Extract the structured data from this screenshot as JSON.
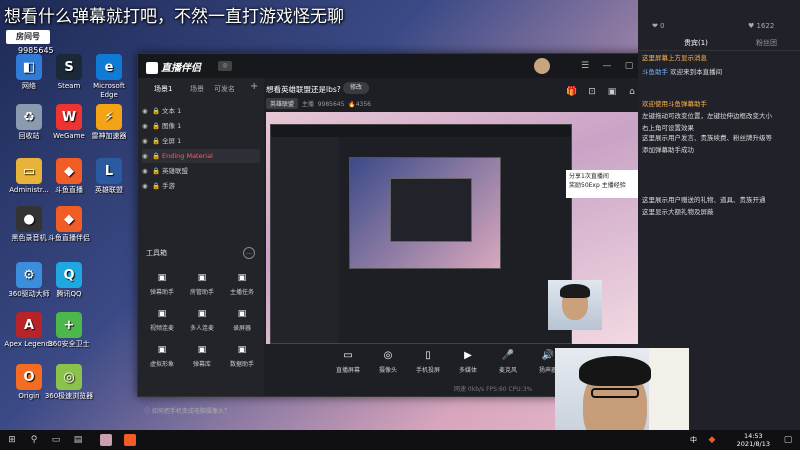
{
  "stream": {
    "title": "想看什么弹幕就打吧，不然一直打游戏怪无聊",
    "viewer_badge": "房间号",
    "viewer_count": "9985645"
  },
  "desktop": {
    "icons": [
      {
        "label": "网络",
        "icon": "network-icon",
        "color": "#2f7bd6",
        "glyph": "◧"
      },
      {
        "label": "Steam",
        "icon": "steam-icon",
        "color": "#1b2838",
        "glyph": "S"
      },
      {
        "label": "Microsoft Edge",
        "icon": "edge-icon",
        "color": "#0f7bd4",
        "glyph": "e"
      },
      {
        "label": "回收站",
        "icon": "recycle-bin-icon",
        "color": "#8a9bb0",
        "glyph": "♻"
      },
      {
        "label": "WeGame",
        "icon": "wegame-icon",
        "color": "#e33",
        "glyph": "W"
      },
      {
        "label": "雷神加速器",
        "icon": "leishen-icon",
        "color": "#f3a313",
        "glyph": "⚡"
      },
      {
        "label": "Administr...",
        "icon": "folder-icon",
        "color": "#e8b33a",
        "glyph": "▭"
      },
      {
        "label": "斗鱼直播",
        "icon": "douyu-icon",
        "color": "#f25c25",
        "glyph": "◆"
      },
      {
        "label": "英雄联盟",
        "icon": "lol-icon",
        "color": "#2a5aa0",
        "glyph": "L"
      },
      {
        "label": "黑色录音机",
        "icon": "recorder-icon",
        "color": "#333",
        "glyph": "●"
      },
      {
        "label": "斗鱼直播伴侣",
        "icon": "douyu-assistant-icon",
        "color": "#f25c25",
        "glyph": "◆"
      },
      {
        "label": "360驱动大师",
        "icon": "driver-icon",
        "color": "#3b8edb",
        "glyph": "⚙"
      },
      {
        "label": "腾讯QQ",
        "icon": "qq-icon",
        "color": "#1ea7e1",
        "glyph": "Q"
      },
      {
        "label": "Apex Legends",
        "icon": "apex-icon",
        "color": "#b8232a",
        "glyph": "A"
      },
      {
        "label": "360安全卫士",
        "icon": "360-safe-icon",
        "color": "#4cb84c",
        "glyph": "+"
      },
      {
        "label": "Origin",
        "icon": "origin-icon",
        "color": "#f36c21",
        "glyph": "O"
      },
      {
        "label": "360极速浏览器",
        "icon": "360-browser-icon",
        "color": "#8bc34a",
        "glyph": "◎"
      }
    ]
  },
  "app": {
    "name": "直播伴侣",
    "titlebar_icons": [
      "avatar-icon",
      "menu-icon",
      "minimize-icon",
      "maximize-icon",
      "close-icon"
    ],
    "left_tabs": [
      "场景1",
      "场景",
      "可发名"
    ],
    "sources": [
      {
        "name": "文本 1",
        "selected": false
      },
      {
        "name": "图像 1",
        "selected": false
      },
      {
        "name": "全屏 1",
        "selected": false
      },
      {
        "name": "Ending Material",
        "selected": true
      },
      {
        "name": "英雄联盟",
        "selected": false
      },
      {
        "name": "手游",
        "selected": false
      }
    ],
    "tools_title": "工具箱",
    "tools": [
      {
        "label": "弹幕助手",
        "icon": "danmaku-icon"
      },
      {
        "label": "房管助手",
        "icon": "room-admin-icon"
      },
      {
        "label": "主播任务",
        "icon": "task-icon"
      },
      {
        "label": "视频连麦",
        "icon": "video-link-icon"
      },
      {
        "label": "多人连麦",
        "icon": "multi-link-icon"
      },
      {
        "label": "录屏器",
        "icon": "recorder-icon"
      },
      {
        "label": "虚拟形象",
        "icon": "avatar-virtual-icon"
      },
      {
        "label": "弹幕库",
        "icon": "danmaku-lib-icon"
      },
      {
        "label": "数据助手",
        "icon": "data-icon"
      }
    ],
    "ask_text": "如何把手机变成电脑摄像头？",
    "room_title": "想看英雄联盟还是lbs?",
    "edit_label": "修改",
    "room_category": "英雄联盟",
    "room_host": "主播",
    "room_id": "9985645",
    "room_heat": "4356",
    "score_box": [
      "分享1次直播间",
      "奖励50Exp 主播经验"
    ],
    "bottom_buttons": [
      {
        "label": "直播屏幕",
        "icon": "screen-icon"
      },
      {
        "label": "摄像头",
        "icon": "camera-icon"
      },
      {
        "label": "手机投屏",
        "icon": "phone-icon"
      },
      {
        "label": "多媒体",
        "icon": "media-icon"
      },
      {
        "label": "麦克风",
        "icon": "mic-icon"
      },
      {
        "label": "扬声器",
        "icon": "speaker-icon"
      }
    ],
    "status_text": "网速 0kb/s  FPS:60  CPU:3%"
  },
  "chat": {
    "stats": [
      "❤ 0",
      "♥ 1622"
    ],
    "tabs": [
      "贵宾(1)",
      "粉丝团"
    ],
    "messages": [
      {
        "user": "",
        "text": "这里屏幕上方显示消息",
        "sys": true
      },
      {
        "user": "斗鱼助手",
        "text": "欢迎来到本直播间",
        "sys": false
      },
      {
        "user": "",
        "text": "欢迎使用斗鱼弹幕助手",
        "sys": true
      },
      {
        "user": "",
        "text": "左键拖动可改变位置，左键拉伸边框改变大小",
        "sys": false
      },
      {
        "user": "",
        "text": "右上角可设置效果",
        "sys": false
      },
      {
        "user": "",
        "text": "这里展示用户发言、贵族续费、粉丝牌升级等",
        "sys": false
      },
      {
        "user": "",
        "text": "添加弹幕助手成功",
        "sys": false
      },
      {
        "user": "",
        "text": "这里展示用户赠送的礼物、道具、贵族开通",
        "sys": false
      },
      {
        "user": "",
        "text": "这里显示大额礼物及屏蔽",
        "sys": false
      }
    ]
  },
  "taskbar": {
    "lang": "中",
    "time": "14:53",
    "date": "2021/8/13"
  }
}
